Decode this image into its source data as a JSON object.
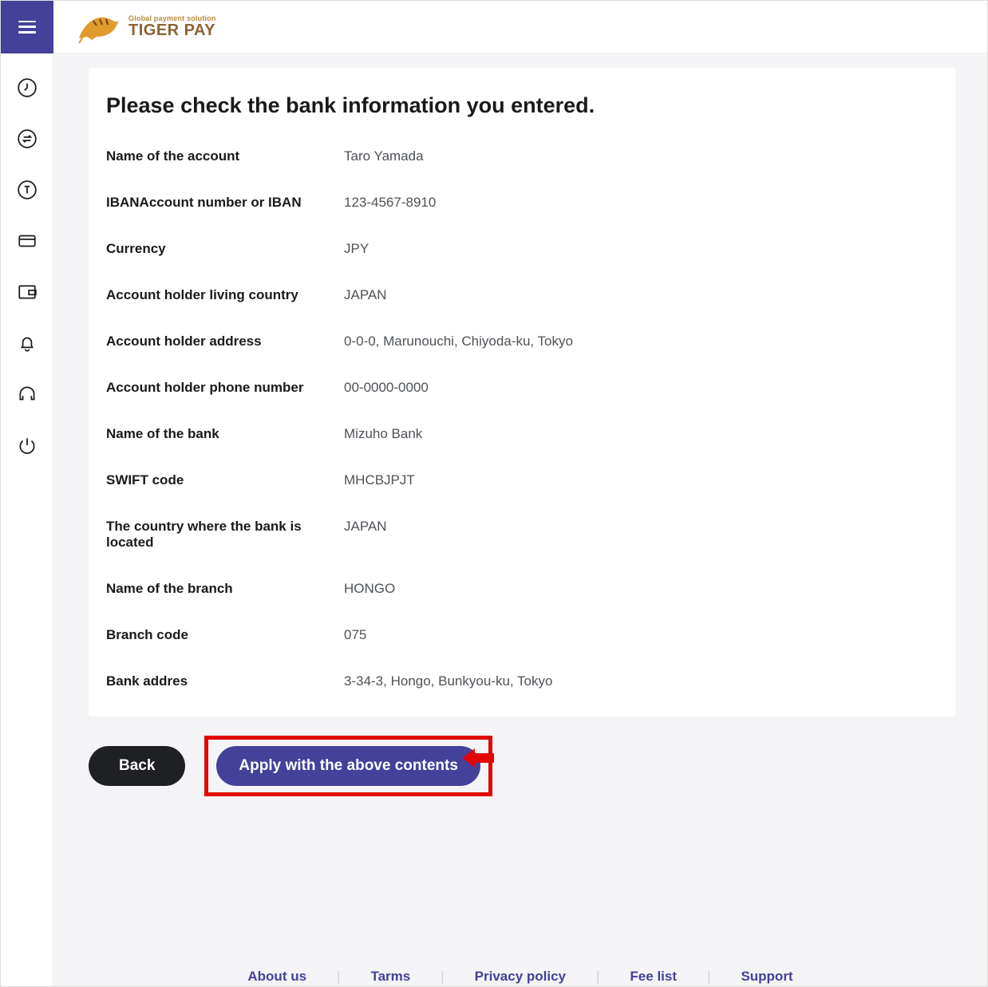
{
  "brand": {
    "tagline": "Global payment solution",
    "name": "TIGER PAY"
  },
  "page": {
    "title": "Please check the bank information you entered."
  },
  "fields": [
    {
      "label": "Name of the account",
      "value": "Taro Yamada"
    },
    {
      "label": "IBANAccount number or IBAN",
      "value": "123-4567-8910"
    },
    {
      "label": "Currency",
      "value": "JPY"
    },
    {
      "label": "Account holder living country",
      "value": "JAPAN"
    },
    {
      "label": "Account holder address",
      "value": "0-0-0, Marunouchi, Chiyoda-ku, Tokyo"
    },
    {
      "label": "Account holder phone number",
      "value": "00-0000-0000"
    },
    {
      "label": "Name of the bank",
      "value": "Mizuho Bank"
    },
    {
      "label": "SWIFT code",
      "value": "MHCBJPJT"
    },
    {
      "label": "The country where the bank is located",
      "value": "JAPAN"
    },
    {
      "label": "Name of the branch",
      "value": "HONGO"
    },
    {
      "label": "Branch code",
      "value": "075"
    },
    {
      "label": "Bank addres",
      "value": "3-34-3, Hongo, Bunkyou-ku, Tokyo"
    }
  ],
  "buttons": {
    "back": "Back",
    "apply": "Apply with the above contents"
  },
  "footer": {
    "about": "About us",
    "terms": "Tarms",
    "privacy": "Privacy policy",
    "fees": "Fee list",
    "support": "Support"
  },
  "colors": {
    "primary": "#44419a",
    "danger": "#e10707",
    "text": "#1a1a1a"
  }
}
